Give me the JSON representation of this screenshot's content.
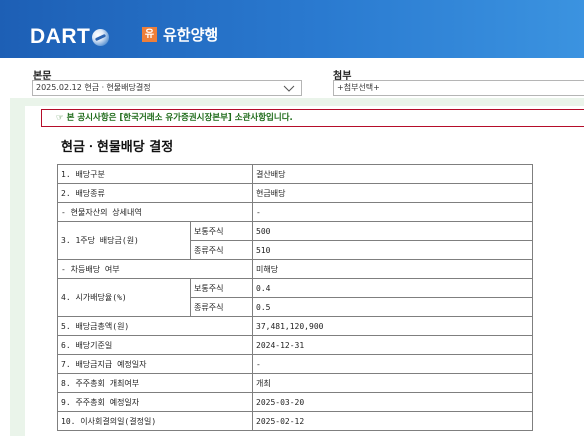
{
  "header": {
    "logo_text": "DART",
    "company_badge": "유",
    "company_name": "유한양행"
  },
  "selectors": {
    "body_label": "본문",
    "body_value": "2025.02.12  현금ㆍ현물배당결정",
    "attach_label": "첨부",
    "attach_value": "+첨부선택+"
  },
  "document": {
    "notice": "☞ 본 공시사항은 [한국거래소 유가증권시장본부] 소관사항입니다.",
    "title": "현금ㆍ현물배당 결정",
    "rows": [
      {
        "label": "1. 배당구분",
        "value": "결산배당"
      },
      {
        "label": "2. 배당종류",
        "value": "현금배당"
      },
      {
        "label": "- 현물자산의 상세내역",
        "value": "-"
      },
      {
        "label": "3. 1주당 배당금(원)",
        "sub1": "보통주식",
        "value1": "500",
        "sub2": "종류주식",
        "value2": "510"
      },
      {
        "label": "- 차등배당 여부",
        "value": "미해당"
      },
      {
        "label": "4. 시가배당율(%)",
        "sub1": "보통주식",
        "value1": "0.4",
        "sub2": "종류주식",
        "value2": "0.5"
      },
      {
        "label": "5. 배당금총액(원)",
        "value": "37,481,120,900"
      },
      {
        "label": "6. 배당기준일",
        "value": "2024-12-31"
      },
      {
        "label": "7. 배당금지급 예정일자",
        "value": "-"
      },
      {
        "label": "8. 주주총회 개최여부",
        "value": "개최"
      },
      {
        "label": "9. 주주총회 예정일자",
        "value": "2025-03-20"
      },
      {
        "label": "10. 이사회결의일(결정일)",
        "value": "2025-02-12"
      }
    ]
  },
  "colors": {
    "header_blue": "#2a7ad0",
    "badge_orange": "#ee7f3a",
    "notice_border": "#b50d2a",
    "notice_text": "#1f6b1a"
  }
}
